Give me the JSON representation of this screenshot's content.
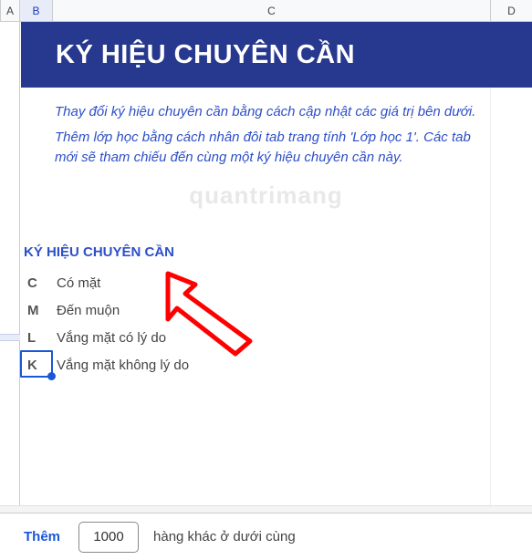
{
  "columns": {
    "A": "A",
    "B": "B",
    "C": "C",
    "D": "D"
  },
  "banner": {
    "title": "KÝ HIỆU CHUYÊN CẦN"
  },
  "instructions": {
    "p1": "Thay đổi ký hiệu chuyên cần bằng cách cập nhật các giá trị bên dưới.",
    "p2": "Thêm lớp học bằng cách nhân đôi tab trang tính 'Lớp học 1'. Các tab mới sẽ tham chiếu đến cùng một ký hiệu chuyên cần này."
  },
  "legend": {
    "title": "KÝ HIỆU CHUYÊN CẦN",
    "items": [
      {
        "code": "C",
        "label": "Có mặt"
      },
      {
        "code": "M",
        "label": "Đến muộn"
      },
      {
        "code": "L",
        "label": "Vắng mặt có lý do"
      },
      {
        "code": "K",
        "label": "Vắng mặt không lý do"
      }
    ]
  },
  "watermark": "quantrimang",
  "addRows": {
    "button": "Thêm",
    "count": "1000",
    "suffix": "hàng khác ở dưới cùng"
  }
}
